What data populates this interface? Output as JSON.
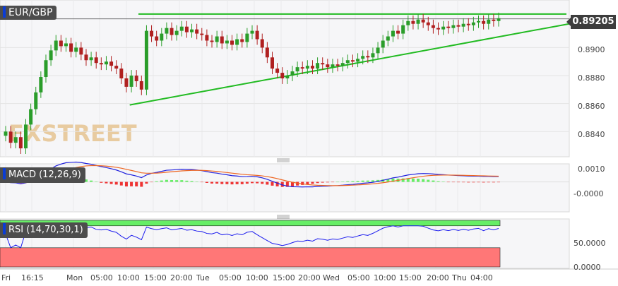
{
  "symbol": "EUR/GBP",
  "last_price": "0.89205",
  "colors": {
    "up": "#2a9d2a",
    "down": "#b02020",
    "trend": "#22bb22",
    "macd": "#2222dd",
    "signal": "#ee6622",
    "hist_pos": "#66ee66",
    "hist_neg": "#ee3333",
    "rsi": "#1a1aee",
    "rsi_overbought": "#66ee66",
    "rsi_oversold": "#ff7777"
  },
  "main_axis": {
    "ylim": [
      0.8824,
      0.8932
    ],
    "ticks": [
      "0.8900",
      "0.8880",
      "0.8860",
      "0.8840"
    ]
  },
  "macd": {
    "label": "MACD (12,26,9)",
    "ylim": [
      -0.0024,
      0.0014
    ],
    "ticks": [
      "0.0010",
      "-0.0000"
    ]
  },
  "rsi": {
    "label": "RSI (14,70,30,1)",
    "ylim": [
      -5,
      80
    ],
    "ticks": [
      "50.0000",
      "0.0000"
    ],
    "overbought": 70,
    "oversold": 30
  },
  "x_axis": {
    "labels": [
      "Fri",
      "16:15",
      "Mon",
      "05:00",
      "10:00",
      "15:00",
      "20:00",
      "Tue",
      "05:00",
      "10:00",
      "15:00",
      "20:00",
      "Wed",
      "05:00",
      "10:00",
      "15:00",
      "20:00",
      "Thu",
      "04:00"
    ]
  },
  "chart_data": {
    "type": "candlestick",
    "title": "EUR/GBP",
    "resistance": 0.8924,
    "trendline": {
      "from": {
        "t": 0.28,
        "price": 0.8859
      },
      "to": {
        "t": 1.0,
        "price": 0.8917
      }
    },
    "closes": [
      0.884,
      0.8832,
      0.8836,
      0.8828,
      0.8845,
      0.8856,
      0.8868,
      0.8879,
      0.8891,
      0.8898,
      0.8905,
      0.8901,
      0.8903,
      0.8897,
      0.89,
      0.8895,
      0.8891,
      0.8893,
      0.8889,
      0.8888,
      0.889,
      0.8887,
      0.8885,
      0.8878,
      0.8872,
      0.888,
      0.8876,
      0.887,
      0.8912,
      0.8908,
      0.8905,
      0.891,
      0.8914,
      0.8909,
      0.8912,
      0.8915,
      0.8911,
      0.8913,
      0.891,
      0.8909,
      0.8905,
      0.8904,
      0.8908,
      0.8903,
      0.8905,
      0.8902,
      0.8906,
      0.8904,
      0.891,
      0.8912,
      0.8906,
      0.89,
      0.8893,
      0.8885,
      0.8882,
      0.8878,
      0.888,
      0.8883,
      0.8886,
      0.8885,
      0.8887,
      0.8885,
      0.8889,
      0.8888,
      0.8886,
      0.8888,
      0.8887,
      0.8889,
      0.8891,
      0.889,
      0.8892,
      0.8894,
      0.8893,
      0.8896,
      0.89,
      0.8905,
      0.8908,
      0.8912,
      0.891,
      0.8916,
      0.8919,
      0.8917,
      0.892,
      0.8918,
      0.8916,
      0.8914,
      0.8913,
      0.8915,
      0.8914,
      0.8916,
      0.8915,
      0.8917,
      0.8916,
      0.8918,
      0.8919,
      0.8917,
      0.892,
      0.8919,
      0.8921
    ]
  }
}
